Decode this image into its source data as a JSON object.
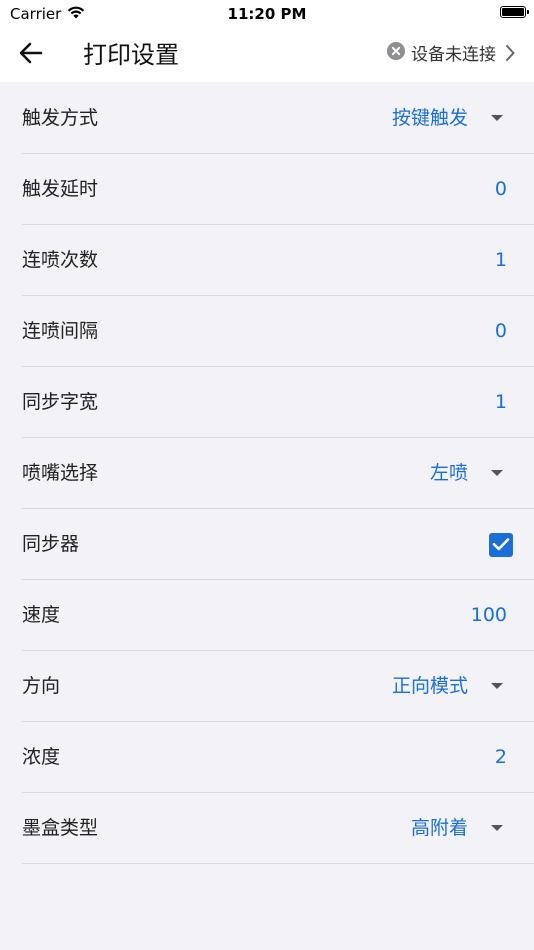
{
  "status_bar": {
    "carrier": "Carrier",
    "time": "11:20 PM"
  },
  "app_bar": {
    "title": "打印设置",
    "device_status": "设备未连接"
  },
  "colors": {
    "accent": "#1a6fd6",
    "background": "#f2f2f7"
  },
  "settings": {
    "trigger_mode": {
      "label": "触发方式",
      "value": "按键触发"
    },
    "trigger_delay": {
      "label": "触发延时",
      "value": "0"
    },
    "burst_count": {
      "label": "连喷次数",
      "value": "1"
    },
    "burst_interval": {
      "label": "连喷间隔",
      "value": "0"
    },
    "sync_char_width": {
      "label": "同步字宽",
      "value": "1"
    },
    "nozzle_select": {
      "label": "喷嘴选择",
      "value": "左喷"
    },
    "synchronizer": {
      "label": "同步器",
      "checked": true
    },
    "speed": {
      "label": "速度",
      "value": "100"
    },
    "direction": {
      "label": "方向",
      "value": "正向模式"
    },
    "density": {
      "label": "浓度",
      "value": "2"
    },
    "cartridge_type": {
      "label": "墨盒类型",
      "value": "高附着"
    }
  }
}
